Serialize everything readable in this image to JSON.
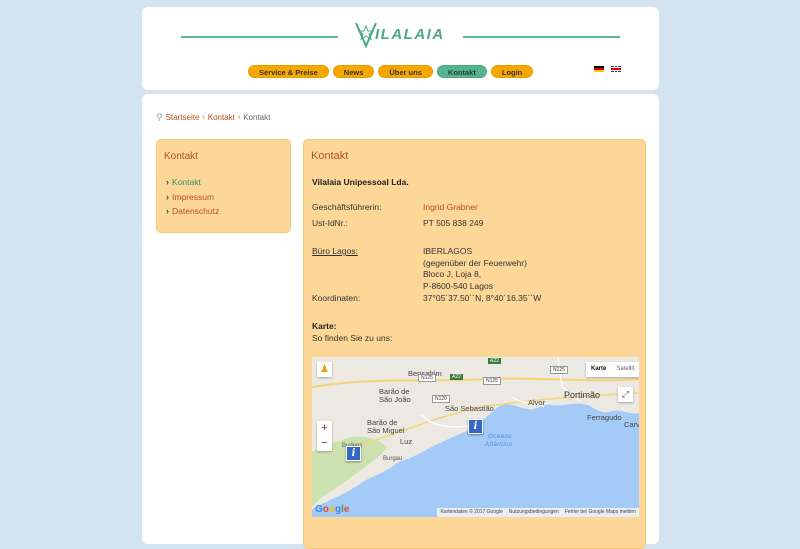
{
  "logo": {
    "text": "ILALAIA"
  },
  "nav": [
    {
      "label": "Service & Preise",
      "active": false
    },
    {
      "label": "News",
      "active": false
    },
    {
      "label": "Über uns",
      "active": false
    },
    {
      "label": "Kontakt",
      "active": true
    },
    {
      "label": "Login",
      "active": false
    }
  ],
  "breadcrumb": {
    "home": "Startseite",
    "parent": "Kontakt",
    "current": "Kontakt"
  },
  "sidebar": {
    "title": "Kontakt",
    "items": [
      {
        "label": "Kontakt",
        "active": true
      },
      {
        "label": "Impressum",
        "active": false
      },
      {
        "label": "Datenschutz",
        "active": false
      }
    ]
  },
  "content": {
    "title": "Kontakt",
    "company": "Vilalaia Unipessoal Lda.",
    "manager_label": "Geschäftsführerin:",
    "manager_value": "Ingrid Grabner",
    "vat_label": "Ust-IdNr.:",
    "vat_value": "PT 505 838 249",
    "office_label": "Büro Lagos:",
    "address": [
      "IBERLAGOS",
      "(gegenüber der Feuerwehr)",
      "Bloco J, Loja 8,",
      "P-8600-540 Lagos"
    ],
    "coords_label": "Koordinaten:",
    "coords_value": "37°05´37.50´´N, 8°40´16.35´´W",
    "map_heading": "Karte:",
    "map_sub": "So finden Sie zu uns:"
  },
  "map": {
    "type_map": "Karte",
    "type_sat": "Satellit",
    "zoom_in": "+",
    "zoom_out": "−",
    "places": {
      "bensafrim": "Bensafrim",
      "barao_joao": "Barão de",
      "barao_joao2": "São João",
      "barao_miguel": "Barão de",
      "barao_miguel2": "São Miguel",
      "sao_sebastiao": "São Sebastião",
      "luz": "Luz",
      "burgau": "Burgau",
      "budens": "Budens",
      "alvor": "Alvor",
      "portimao": "Portimão",
      "ferragudo": "Ferragudo",
      "carvoeiro": "Carvoe",
      "ocean1": "Oceano",
      "ocean2": "Atlântico",
      "lagos_part": "L"
    },
    "roads": {
      "a22a": "A22",
      "a22b": "A22",
      "n125a": "N125",
      "n125b": "N125",
      "n125c": "N125",
      "n120": "N120"
    },
    "marker_glyph": "i",
    "google": "Google",
    "attribution": [
      "Kartendaten © 2017 Google",
      "Nutzungsbedingungen",
      "Fehler bei Google Maps melden"
    ]
  }
}
